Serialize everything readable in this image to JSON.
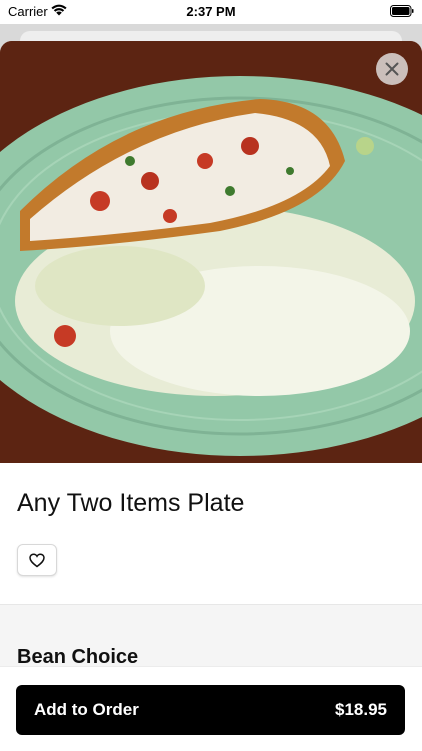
{
  "status_bar": {
    "carrier": "Carrier",
    "time": "2:37 PM"
  },
  "item": {
    "title": "Any Two Items Plate",
    "image_alt_icon": "food-photo",
    "favorite_icon": "heart-icon"
  },
  "options": {
    "section_title": "Bean Choice"
  },
  "order": {
    "label": "Add to Order",
    "price": "$18.95"
  },
  "colors": {
    "accent": "#000000",
    "plate": "#93c8a8"
  }
}
